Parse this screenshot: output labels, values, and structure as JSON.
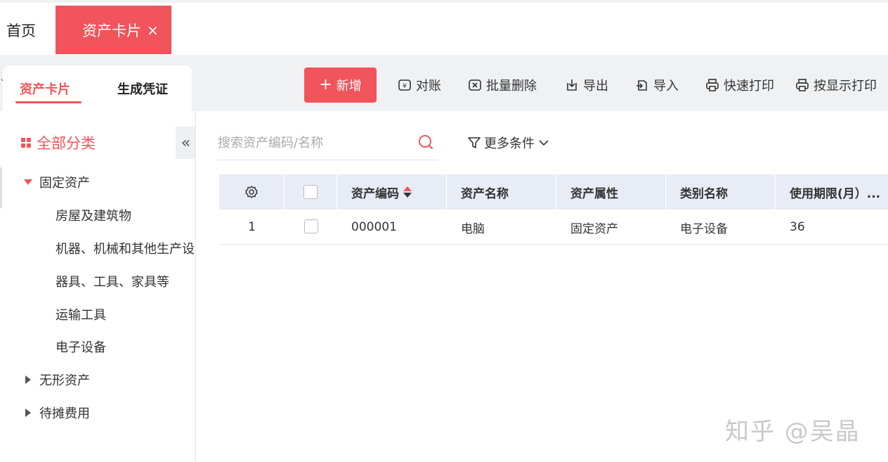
{
  "tabs": {
    "home": "首页",
    "active": "资产卡片",
    "close": "×"
  },
  "subtabs": {
    "asset_card": "资产卡片",
    "generate_voucher": "生成凭证"
  },
  "toolbar": {
    "add": "新增",
    "add_plus": "+",
    "reconcile": "对账",
    "batch_delete": "批量删除",
    "export": "导出",
    "import": "导入",
    "quick_print": "快速打印",
    "print_by_display": "按显示打印"
  },
  "sidebar": {
    "all_categories": "全部分类",
    "collapse": "«",
    "tree": [
      {
        "label": "固定资产",
        "expanded": true
      },
      {
        "label": "房屋及建筑物"
      },
      {
        "label": "机器、机械和其他生产设"
      },
      {
        "label": "器具、工具、家具等"
      },
      {
        "label": "运输工具"
      },
      {
        "label": "电子设备"
      },
      {
        "label": "无形资产",
        "expanded": false
      },
      {
        "label": "待摊费用",
        "expanded": false
      }
    ]
  },
  "search": {
    "placeholder": "搜索资产编码/名称",
    "value": ""
  },
  "filter": {
    "more_conditions": "更多条件"
  },
  "table": {
    "columns": [
      "资产编码",
      "资产名称",
      "资产属性",
      "类别名称",
      "使用期限(月）..."
    ],
    "rows": [
      {
        "index": "1",
        "code": "000001",
        "name": "电脑",
        "attribute": "固定资产",
        "category": "电子设备",
        "term": "36"
      }
    ]
  },
  "watermark": "知乎 @吴晶",
  "colors": {
    "accent": "#f2545b",
    "header_bg": "#e8ecf5",
    "band_bg": "#f0f1f3"
  }
}
